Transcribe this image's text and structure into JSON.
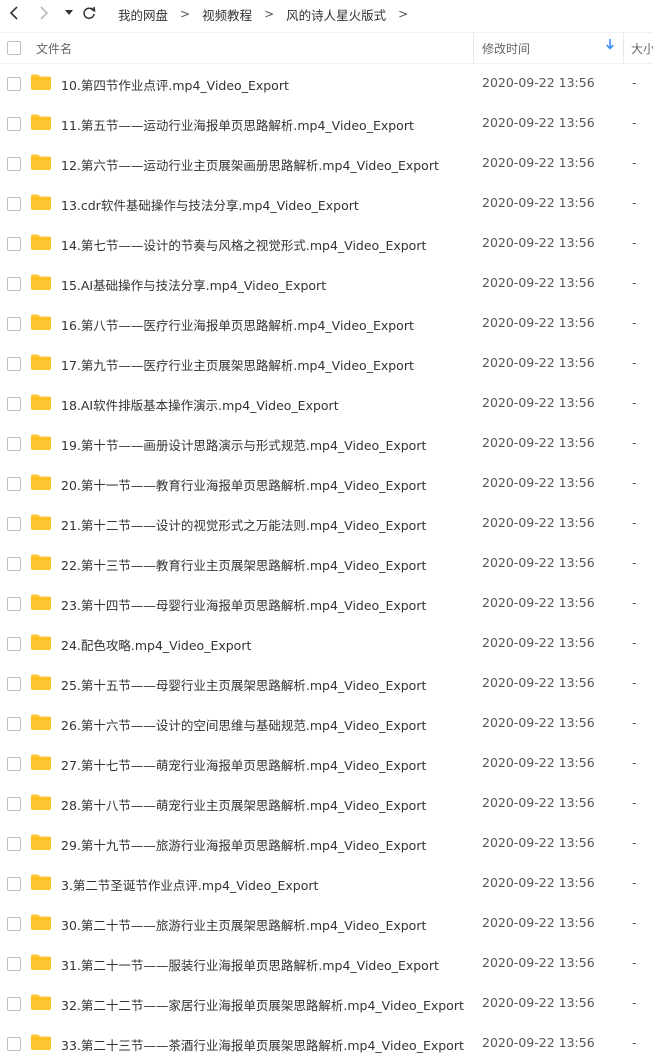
{
  "breadcrumb": {
    "items": [
      "我的网盘",
      "视频教程",
      "风的诗人星火版式"
    ],
    "separator": ">"
  },
  "header": {
    "name_label": "文件名",
    "time_label": "修改时间",
    "size_label": "大小",
    "sort_icon": "arrow-down-icon"
  },
  "colors": {
    "folder": "#FFC533",
    "accent": "#3B8CFF"
  },
  "files": [
    {
      "name": "10.第四节作业点评.mp4_Video_Export",
      "time": "2020-09-22 13:56",
      "size": "-"
    },
    {
      "name": "11.第五节——运动行业海报单页思路解析.mp4_Video_Export",
      "time": "2020-09-22 13:56",
      "size": "-"
    },
    {
      "name": "12.第六节——运动行业主页展架画册思路解析.mp4_Video_Export",
      "time": "2020-09-22 13:56",
      "size": "-"
    },
    {
      "name": "13.cdr软件基础操作与技法分享.mp4_Video_Export",
      "time": "2020-09-22 13:56",
      "size": "-"
    },
    {
      "name": "14.第七节——设计的节奏与风格之视觉形式.mp4_Video_Export",
      "time": "2020-09-22 13:56",
      "size": "-"
    },
    {
      "name": "15.AI基础操作与技法分享.mp4_Video_Export",
      "time": "2020-09-22 13:56",
      "size": "-"
    },
    {
      "name": "16.第八节——医疗行业海报单页思路解析.mp4_Video_Export",
      "time": "2020-09-22 13:56",
      "size": "-"
    },
    {
      "name": "17.第九节——医疗行业主页展架思路解析.mp4_Video_Export",
      "time": "2020-09-22 13:56",
      "size": "-"
    },
    {
      "name": "18.AI软件排版基本操作演示.mp4_Video_Export",
      "time": "2020-09-22 13:56",
      "size": "-"
    },
    {
      "name": "19.第十节——画册设计思路演示与形式规范.mp4_Video_Export",
      "time": "2020-09-22 13:56",
      "size": "-"
    },
    {
      "name": "20.第十一节——教育行业海报单页思路解析.mp4_Video_Export",
      "time": "2020-09-22 13:56",
      "size": "-"
    },
    {
      "name": "21.第十二节——设计的视觉形式之万能法则.mp4_Video_Export",
      "time": "2020-09-22 13:56",
      "size": "-"
    },
    {
      "name": "22.第十三节——教育行业主页展架思路解析.mp4_Video_Export",
      "time": "2020-09-22 13:56",
      "size": "-"
    },
    {
      "name": "23.第十四节——母婴行业海报单页思路解析.mp4_Video_Export",
      "time": "2020-09-22 13:56",
      "size": "-"
    },
    {
      "name": "24.配色攻略.mp4_Video_Export",
      "time": "2020-09-22 13:56",
      "size": "-"
    },
    {
      "name": "25.第十五节——母婴行业主页展架思路解析.mp4_Video_Export",
      "time": "2020-09-22 13:56",
      "size": "-"
    },
    {
      "name": "26.第十六节——设计的空间思维与基础规范.mp4_Video_Export",
      "time": "2020-09-22 13:56",
      "size": "-"
    },
    {
      "name": "27.第十七节——萌宠行业海报单页思路解析.mp4_Video_Export",
      "time": "2020-09-22 13:56",
      "size": "-"
    },
    {
      "name": "28.第十八节——萌宠行业主页展架思路解析.mp4_Video_Export",
      "time": "2020-09-22 13:56",
      "size": "-"
    },
    {
      "name": "29.第十九节——旅游行业海报单页思路解析.mp4_Video_Export",
      "time": "2020-09-22 13:56",
      "size": "-"
    },
    {
      "name": "3.第二节圣诞节作业点评.mp4_Video_Export",
      "time": "2020-09-22 13:56",
      "size": "-"
    },
    {
      "name": "30.第二十节——旅游行业主页展架思路解析.mp4_Video_Export",
      "time": "2020-09-22 13:56",
      "size": "-"
    },
    {
      "name": "31.第二十一节——服装行业海报单页思路解析.mp4_Video_Export",
      "time": "2020-09-22 13:56",
      "size": "-"
    },
    {
      "name": "32.第二十二节——家居行业海报单页展架思路解析.mp4_Video_Export",
      "time": "2020-09-22 13:56",
      "size": "-"
    },
    {
      "name": "33.第二十三节——茶酒行业海报单页展架思路解析.mp4_Video_Export",
      "time": "2020-09-22 13:56",
      "size": "-"
    }
  ]
}
